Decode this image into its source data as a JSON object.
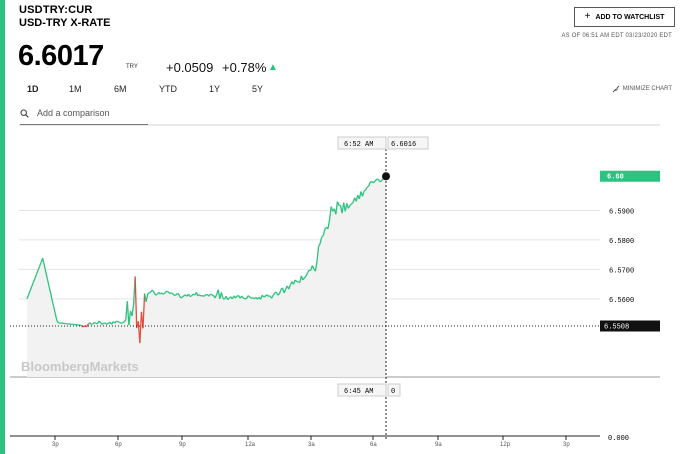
{
  "quote": {
    "ticker": "USDTRY:CUR",
    "name": "USD-TRY X-RATE",
    "price": "6.6017",
    "currency": "TRY",
    "change": "+0.0509",
    "change_pct": "+0.78%",
    "trend_arrow": "▲"
  },
  "header": {
    "watchlist_label": "ADD TO WATCHLIST",
    "as_of": "AS OF 06:51 AM EDT 03/23/2020 EDT"
  },
  "ranges": [
    "1D",
    "1M",
    "6M",
    "YTD",
    "1Y",
    "5Y"
  ],
  "active_range": "1D",
  "minimize_label": "MINIMIZE CHART",
  "compare": {
    "placeholder": "Add a comparison"
  },
  "watermark": "BloombergMarkets",
  "colors": {
    "accent": "#2bc37f",
    "down": "#e74c3c",
    "text": "#000000"
  },
  "chart_data": {
    "type": "line",
    "x_ticks": [
      "3p",
      "6p",
      "9p",
      "12a",
      "3a",
      "6a",
      "9a",
      "12p",
      "3p"
    ],
    "y_ticks": [
      "6.5600",
      "6.5700",
      "6.5800",
      "6.5900"
    ],
    "y_range": [
      6.5508,
      6.6017
    ],
    "price_badge": "6.60",
    "prev_close_badge": "6.5508",
    "crosshair_time": "6:52 AM",
    "crosshair_value": "6.6016",
    "volume_time": "6:45 AM",
    "volume_value": "0",
    "volume_zero_label": "0.000",
    "series": [
      {
        "values": [
          6.56,
          6.5614,
          6.5628,
          6.5642,
          6.5655,
          6.5669,
          6.5683,
          6.5697,
          6.571,
          6.5724,
          6.5738,
          6.5715,
          6.5691,
          6.5668,
          6.5644,
          6.5621,
          6.5598,
          6.5574,
          6.5551,
          6.5527,
          6.5519,
          6.5518,
          6.5518,
          6.5517,
          6.5517,
          6.5516,
          6.5515,
          6.5515,
          6.5514,
          6.5514,
          6.5513,
          6.5513,
          6.5512,
          6.5511,
          6.5511,
          6.5508,
          6.5505,
          6.5509,
          6.5505,
          6.5514,
          6.5519,
          6.5514,
          6.5515,
          6.552,
          6.5517,
          6.5516,
          6.5525,
          6.552,
          6.5513,
          6.5518,
          6.5518,
          6.5514,
          6.5517,
          6.5521,
          6.5514,
          6.5523,
          6.5518,
          6.5524,
          6.5523,
          6.552,
          6.5518,
          6.5519,
          6.5522,
          6.5529,
          6.5592,
          6.5511,
          6.5559,
          6.5542,
          6.5581,
          6.5676,
          6.5501,
          6.5524,
          6.545,
          6.5556,
          6.55,
          6.5618,
          6.559,
          6.5617,
          6.5621,
          6.5624,
          6.563,
          6.5622,
          6.5613,
          6.5615,
          6.5622,
          6.5617,
          6.562,
          6.5616,
          6.562,
          6.5626,
          6.5624,
          6.5618,
          6.5621,
          6.5617,
          6.5612,
          6.5613,
          6.5619,
          6.5614,
          6.5603,
          6.5606,
          6.561,
          6.5614,
          6.5609,
          6.5616,
          6.5608,
          6.561,
          6.5616,
          6.5613,
          6.5622,
          6.561,
          6.5614,
          6.561,
          6.5611,
          6.5609,
          6.5614,
          6.5615,
          6.5609,
          6.5616,
          6.5614,
          6.5611,
          6.5603,
          6.5616,
          6.5631,
          6.56,
          6.5622,
          6.5601,
          6.5599,
          6.5609,
          6.5597,
          6.5602,
          6.5607,
          6.56,
          6.561,
          6.5603,
          6.561,
          6.5611,
          6.5602,
          6.561,
          6.5602,
          6.5601,
          6.56,
          6.5611,
          6.5607,
          6.5602,
          6.5604,
          6.56,
          6.5605,
          6.5599,
          6.5606,
          6.5598,
          6.5613,
          6.5606,
          6.5609,
          6.5614,
          6.5609,
          6.561,
          6.5602,
          6.5612,
          6.562,
          6.5623,
          6.5613,
          6.5617,
          6.5632,
          6.5637,
          6.562,
          6.5633,
          6.5644,
          6.5633,
          6.5648,
          6.5659,
          6.5649,
          6.5664,
          6.5659,
          6.5658,
          6.5655,
          6.5678,
          6.5664,
          6.5671,
          6.5677,
          6.569,
          6.5697,
          6.5697,
          6.5713,
          6.5701,
          6.5694,
          6.5728,
          6.5778,
          6.5788,
          6.581,
          6.5815,
          6.5836,
          6.5843,
          6.5838,
          6.5868,
          6.5913,
          6.5897,
          6.5906,
          6.5887,
          6.593,
          6.5917,
          6.5917,
          6.5891,
          6.5927,
          6.5897,
          6.5924,
          6.5907,
          6.5917,
          6.5922,
          6.5927,
          6.5943,
          6.5931,
          6.5952,
          6.5939,
          6.5964,
          6.5948,
          6.5965,
          6.597,
          6.5979,
          6.5983,
          6.5997,
          6.5998,
          6.5994,
          6.5999,
          6.6006,
          6.6006,
          6.5998,
          6.5999,
          6.6007,
          6.601,
          6.6016
        ]
      }
    ]
  }
}
